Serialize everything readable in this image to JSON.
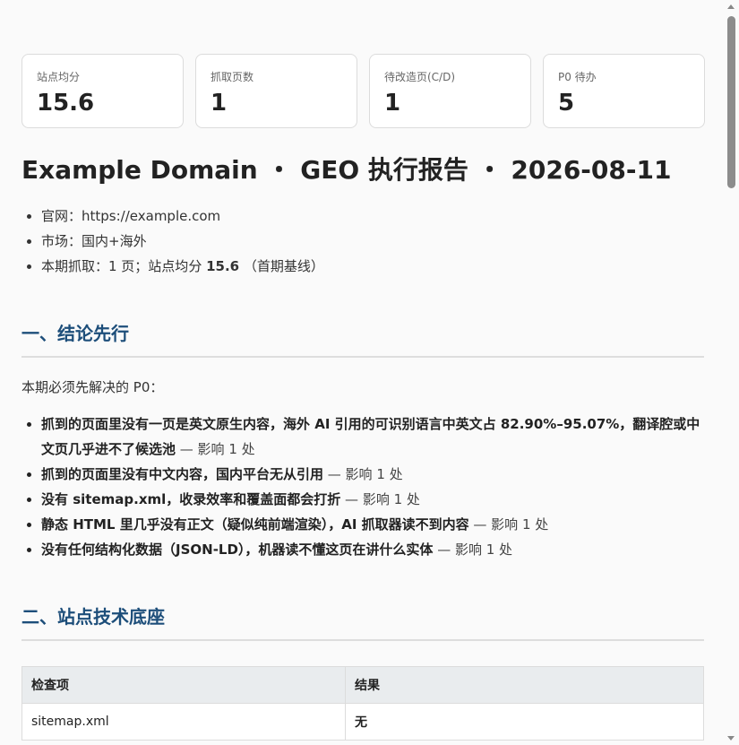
{
  "stats": [
    {
      "label": "站点均分",
      "value": "15.6"
    },
    {
      "label": "抓取页数",
      "value": "1"
    },
    {
      "label": "待改造页(C/D)",
      "value": "1"
    },
    {
      "label": "P0 待办",
      "value": "5"
    }
  ],
  "report": {
    "title": "Example Domain ・ GEO 执行报告 ・ 2026-08-11",
    "meta": {
      "site_label": "官网：",
      "site_value": "https://example.com",
      "market_label": "市场：",
      "market_value": "国内+海外",
      "crawl_prefix": "本期抓取：1 页；站点均分 ",
      "crawl_score": "15.6",
      "crawl_suffix": " （首期基线）"
    }
  },
  "section1": {
    "title": "一、结论先行",
    "intro": "本期必须先解决的 P0：",
    "items": [
      {
        "text": "抓到的页面里没有一页是英文原生内容，海外 AI 引用的可识别语言中英文占 82.90%–95.07%，翻译腔或中文页几乎进不了候选池",
        "impact": " — 影响 1 处"
      },
      {
        "text": "抓到的页面里没有中文内容，国内平台无从引用",
        "impact": " — 影响 1 处"
      },
      {
        "text": "没有 sitemap.xml，收录效率和覆盖面都会打折",
        "impact": " — 影响 1 处"
      },
      {
        "text": "静态 HTML 里几乎没有正文（疑似纯前端渲染），AI 抓取器读不到内容",
        "impact": " — 影响 1 处"
      },
      {
        "text": "没有任何结构化数据（JSON-LD），机器读不懂这页在讲什么实体",
        "impact": " — 影响 1 处"
      }
    ]
  },
  "section2": {
    "title": "二、站点技术底座",
    "table": {
      "headers": [
        "检查项",
        "结果"
      ],
      "rows": [
        [
          "sitemap.xml",
          "无"
        ]
      ]
    }
  }
}
